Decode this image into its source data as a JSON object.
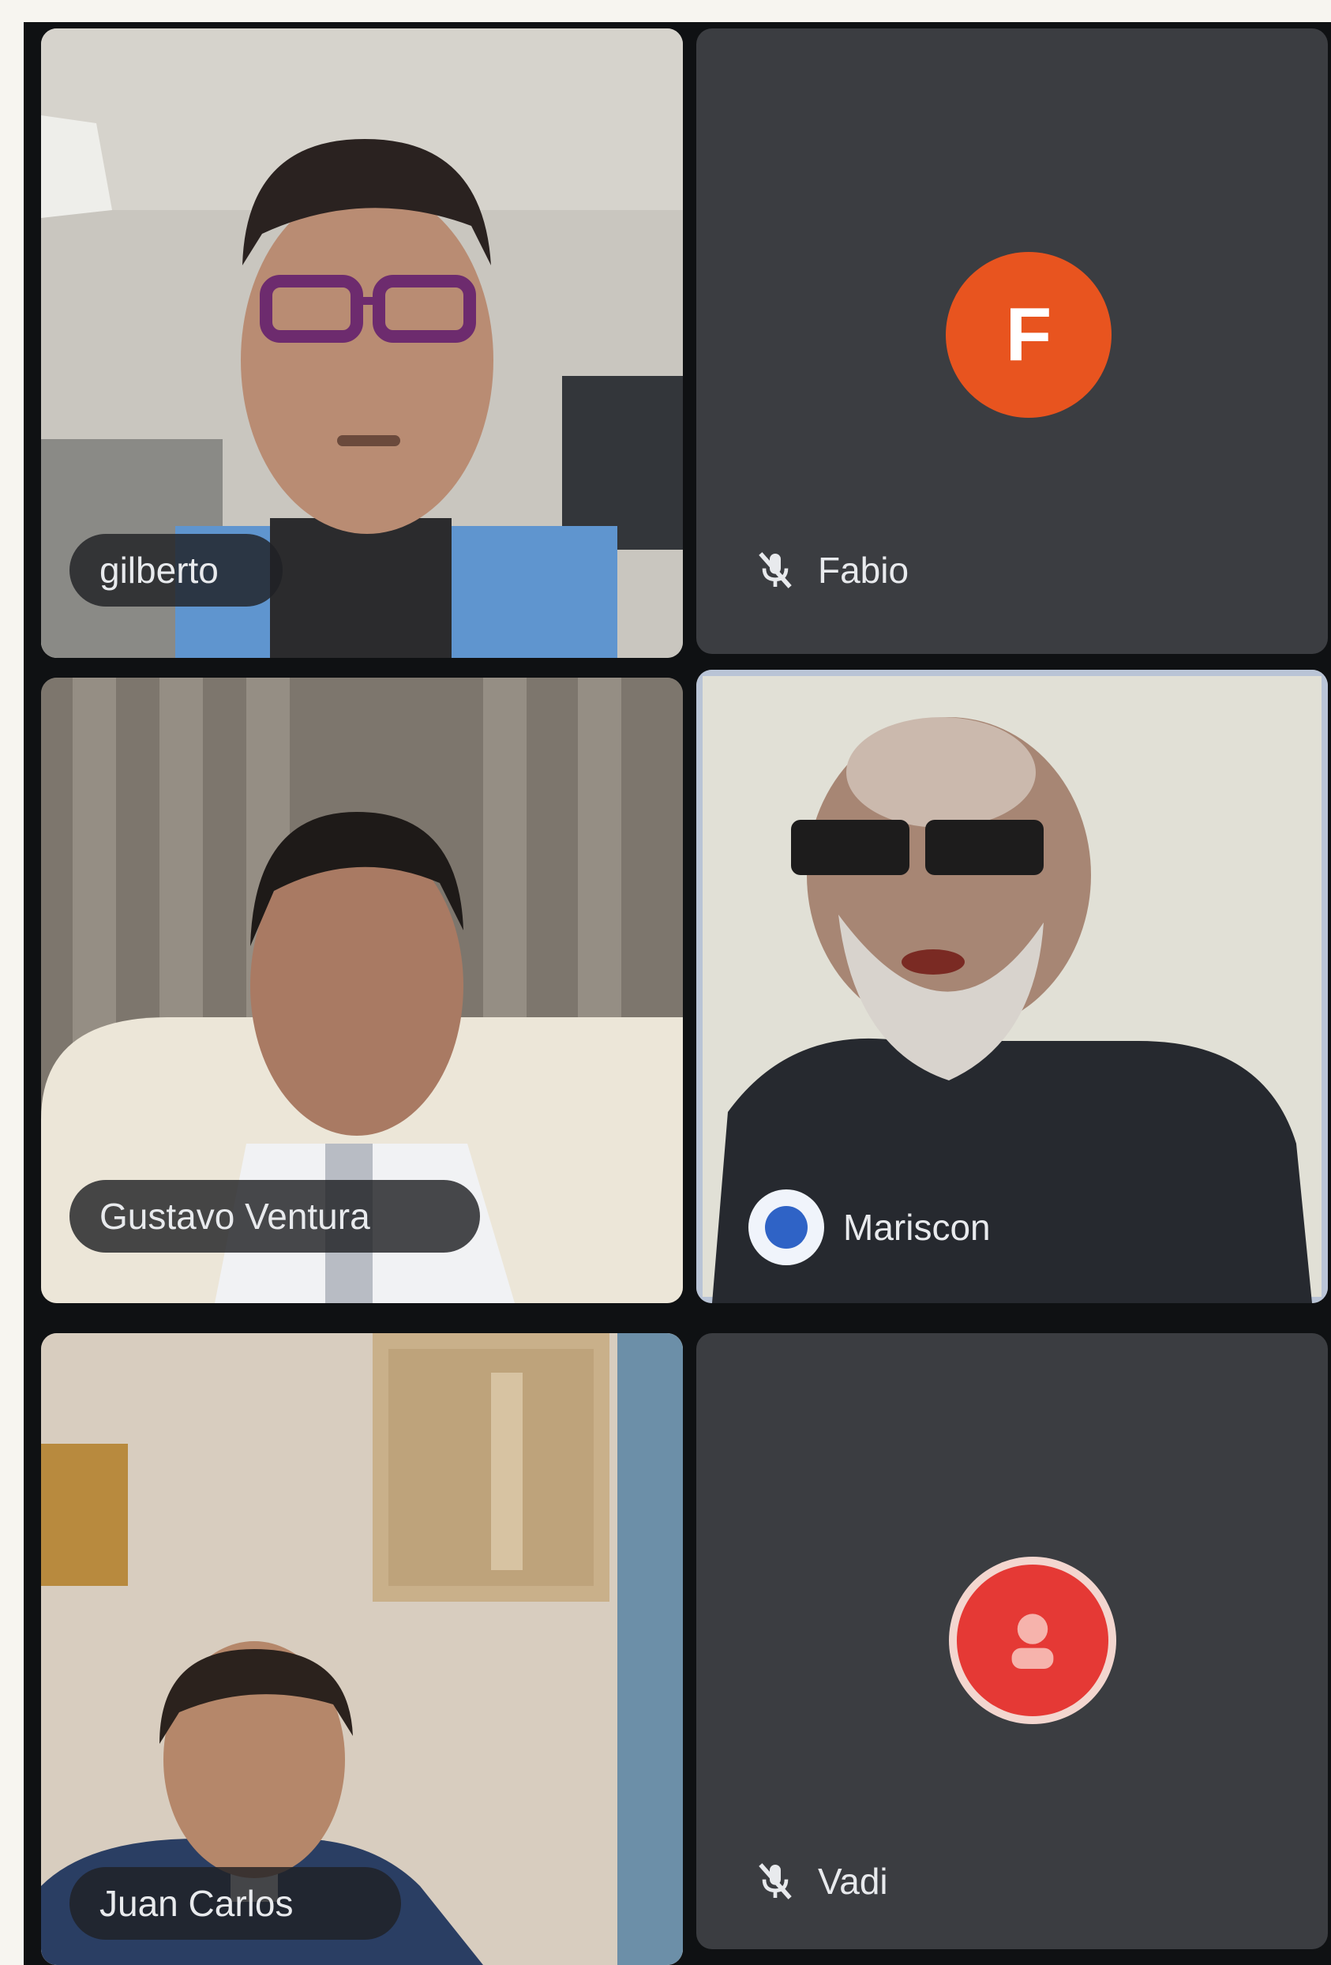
{
  "participants": [
    {
      "name": "gilberto",
      "state": "camera-on"
    },
    {
      "name": "Fabio",
      "state": "camera-off",
      "avatar_initial": "F",
      "avatar_color": "#e8541f",
      "mic": "muted"
    },
    {
      "name": "Gustavo Ventura",
      "state": "camera-on"
    },
    {
      "name": "Mariscon",
      "state": "camera-on",
      "speaking": true,
      "highlight_color": "#b9c4d6"
    },
    {
      "name": "Juan Carlos",
      "state": "camera-on"
    },
    {
      "name": "Vadi",
      "state": "camera-off",
      "avatar_color": "#e53935",
      "mic": "muted"
    }
  ],
  "colors": {
    "tile_background": "#3b3d41",
    "grid_background": "#0f1113",
    "pill_background": "#202124",
    "speaking_indicator": "#2f63c6"
  }
}
